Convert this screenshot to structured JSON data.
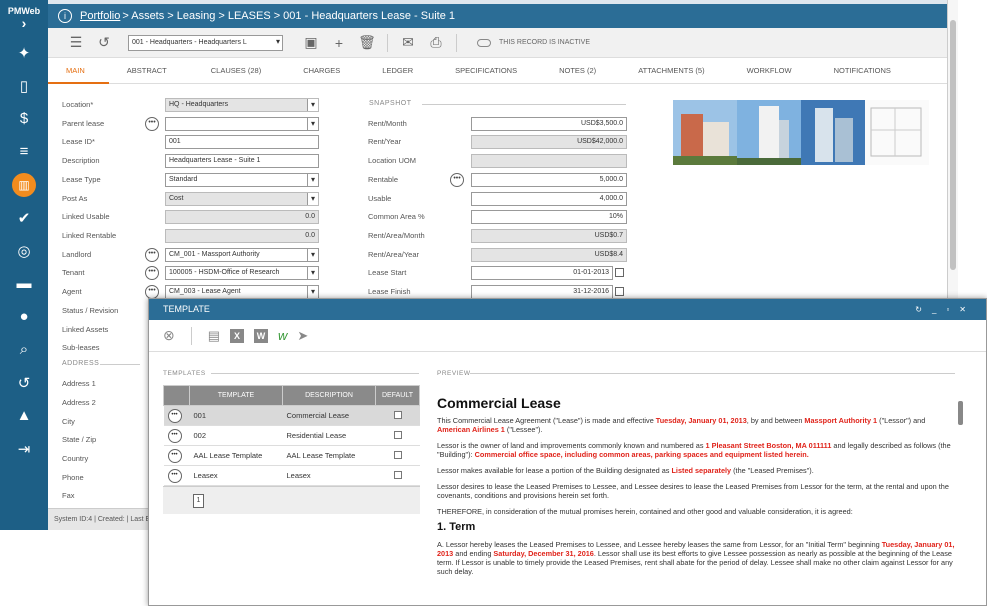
{
  "sidebar": {
    "logo": "PMWeb",
    "arrow": "›",
    "icons": [
      "bulb-icon",
      "document-icon",
      "dollar-icon",
      "gantt-icon",
      "building-icon",
      "check-icon",
      "globe-icon",
      "briefcase-icon",
      "user-icon",
      "search-icon",
      "history-icon",
      "graduation-icon",
      "logout-icon"
    ]
  },
  "title": {
    "crumb_portfolio": "Portfolio",
    "crumb_rest": "> Assets > Leasing > LEASES > 001 - Headquarters Lease - Suite 1"
  },
  "toolbar": {
    "record": "001 - Headquarters - Headquarters L",
    "inactive": "THIS RECORD IS INACTIVE"
  },
  "tabs": [
    "MAIN",
    "ABSTRACT",
    "CLAUSES (28)",
    "CHARGES",
    "LEDGER",
    "SPECIFICATIONS",
    "NOTES (2)",
    "ATTACHMENTS (5)",
    "WORKFLOW",
    "NOTIFICATIONS"
  ],
  "left_labels": [
    "Location*",
    "Parent lease",
    "Lease ID*",
    "Description",
    "Lease Type",
    "Post As",
    "Linked Usable",
    "Linked Rentable",
    "Landlord",
    "Tenant",
    "Agent",
    "Status / Revision",
    "Linked Assets",
    "Sub-leases"
  ],
  "left_values": {
    "location": "HQ - Headquarters",
    "parent": "",
    "lease_id": "001",
    "description": "Headquarters Lease - Suite 1",
    "lease_type": "Standard",
    "post_as": "Cost",
    "linked_usable": "0.0",
    "linked_rentable": "0.0",
    "landlord": "CM_001 - Massport Authority",
    "tenant": "100005 - HSDM-Office of Research",
    "agent": "CM_003 - Lease Agent"
  },
  "address": {
    "section": "ADDRESS",
    "labels": [
      "Address 1",
      "Address 2",
      "City",
      "State / Zip",
      "Country",
      "Phone",
      "Fax"
    ]
  },
  "snapshot": {
    "section": "SNAPSHOT",
    "labels": [
      "Rent/Month",
      "Rent/Year",
      "Location UOM",
      "Rentable",
      "Usable",
      "Common Area %",
      "Rent/Area/Month",
      "Rent/Area/Year",
      "Lease Start",
      "Lease Finish"
    ],
    "values": [
      "USD$3,500.0",
      "USD$42,000.0",
      "",
      "5,000.0",
      "4,000.0",
      "10%",
      "USD$0.7",
      "USD$8.4",
      "01-01-2013",
      "31-12-2016"
    ]
  },
  "statusbar": "System ID:4 | Created: | Last Edited:22-",
  "modal": {
    "title": "TEMPLATE",
    "templates_section": "TEMPLATES",
    "preview_section": "PREVIEW",
    "columns": [
      "TEMPLATE",
      "DESCRIPTION",
      "DEFAULT"
    ],
    "rows": [
      {
        "template": "001",
        "description": "Commercial Lease"
      },
      {
        "template": "002",
        "description": "Residential Lease"
      },
      {
        "template": "AAL Lease Template",
        "description": "AAL Lease Template"
      },
      {
        "template": "Leasex",
        "description": "Leasex"
      }
    ],
    "page": "1",
    "preview": {
      "h1": "Commercial Lease",
      "p1a": "This Commercial Lease Agreement (\"Lease\") is made and effective ",
      "p1b": "Tuesday, January 01, 2013",
      "p1c": ", by and between ",
      "p1d": "Massport Authority 1",
      "p1e": " (\"Lessor\") and ",
      "p1f": "American Airlines 1",
      "p1g": " (\"Lessee\").",
      "p2a": "Lessor is the owner of land and improvements commonly known and numbered as ",
      "p2b": "1 Pleasant Street Boston, MA 011111",
      "p2c": " and legally described as follows (the \"Building\"): ",
      "p2d": "Commercial office space, including common areas, parking spaces and equipment listed herein.",
      "p3a": "Lessor makes available for lease a portion of the Building designated as ",
      "p3b": "Listed separately",
      "p3c": " (the \"Leased Premises\").",
      "p4": "Lessor desires to lease the Leased Premises to Lessee, and Lessee desires to lease the Leased Premises from Lessor for the term, at the rental and upon the covenants, conditions and provisions herein set forth.",
      "p5": "THEREFORE, in consideration of the mutual promises herein, contained and other good and valuable consideration, it is agreed:",
      "h2": "1. Term",
      "p6a": "A. Lessor hereby leases the Leased Premises to Lessee, and Lessee hereby leases the same from Lessor, for an \"Initial Term\" beginning ",
      "p6b": "Tuesday, January 01, 2013",
      "p6c": " and ending ",
      "p6d": "Saturday, December 31, 2016",
      "p6e": ". Lessor shall use its best efforts to give Lessee possession as nearly as possible at the beginning of the Lease term. If Lessor is unable to timely provide the Leased Premises, rent shall abate for the period of delay. Lessee shall make no other claim against Lessor for any such delay."
    }
  },
  "colors": {
    "sidebar": "#1d5f86",
    "titlebar": "#2b6d96",
    "accent": "#e56f12",
    "red_text": "#e0241b"
  }
}
